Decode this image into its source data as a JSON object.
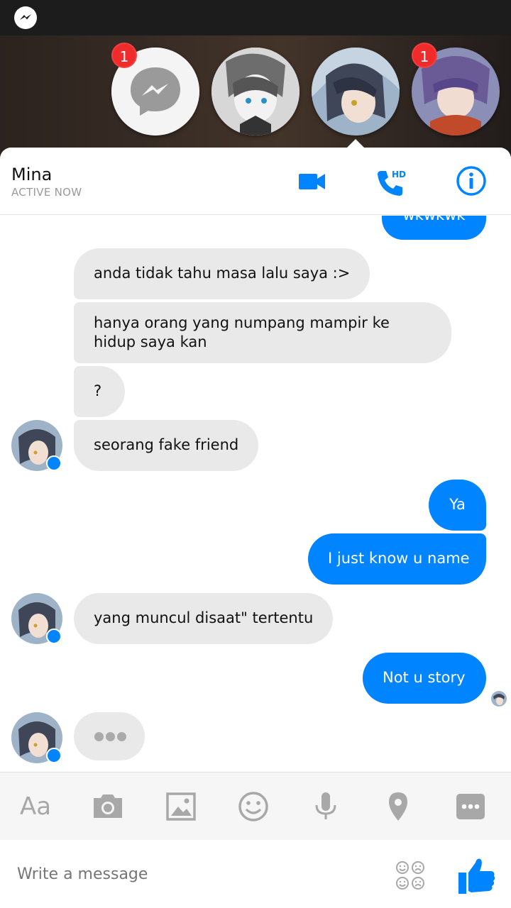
{
  "colors": {
    "accent": "#0084ff",
    "incoming_bubble": "#e9e9e9",
    "badge": "#f02b2b",
    "icon_gray": "#a8a8a8"
  },
  "chat_heads": [
    {
      "name": "messenger-head",
      "badge": "1"
    },
    {
      "name": "contact-head-2",
      "badge": ""
    },
    {
      "name": "contact-head-mina",
      "badge": ""
    },
    {
      "name": "contact-head-4",
      "badge": "1"
    }
  ],
  "header": {
    "name": "Mina",
    "status": "ACTIVE NOW",
    "video_icon": "video-camera-icon",
    "call_icon": "phone-hd-icon",
    "call_hd_label": "HD",
    "info_icon": "info-icon"
  },
  "messages": {
    "m0": "wkwkwk",
    "m1": "anda tidak tahu masa lalu saya :>",
    "m2_line1": "hanya orang yang numpang mampir ke",
    "m2_line2": "hidup saya kan",
    "m3": "?",
    "m4": "seorang fake friend",
    "m5": "Ya",
    "m6": "I just know u name",
    "m7": "yang muncul disaat\" tertentu",
    "m8": "Not u story"
  },
  "toolbar": {
    "text_label": "Aa",
    "icons": [
      "camera-icon",
      "gallery-icon",
      "emoji-icon",
      "microphone-icon",
      "location-icon",
      "more-icon"
    ]
  },
  "composer": {
    "placeholder": "Write a message",
    "value": ""
  }
}
